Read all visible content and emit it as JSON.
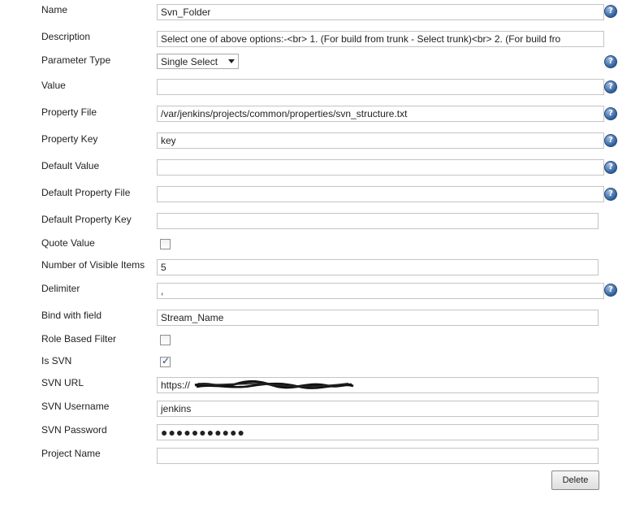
{
  "fields": {
    "name": {
      "label": "Name",
      "value": "Svn_Folder"
    },
    "description": {
      "label": "Description",
      "value": "Select one of above options:-<br> 1. (For build from trunk - Select trunk)<br> 2. (For build fro"
    },
    "parameter_type": {
      "label": "Parameter Type",
      "value": "Single Select"
    },
    "value": {
      "label": "Value",
      "value": ""
    },
    "property_file": {
      "label": "Property File",
      "value": "/var/jenkins/projects/common/properties/svn_structure.txt"
    },
    "property_key": {
      "label": "Property Key",
      "value": "key"
    },
    "default_value": {
      "label": "Default Value",
      "value": ""
    },
    "default_property_file": {
      "label": "Default Property File",
      "value": ""
    },
    "default_property_key": {
      "label": "Default Property Key",
      "value": ""
    },
    "quote_value": {
      "label": "Quote Value",
      "checked": false
    },
    "visible_items": {
      "label": "Number of Visible Items",
      "value": "5"
    },
    "delimiter": {
      "label": "Delimiter",
      "value": ","
    },
    "bind_with_field": {
      "label": "Bind with field",
      "value": "Stream_Name"
    },
    "role_based_filter": {
      "label": "Role Based Filter",
      "checked": false
    },
    "is_svn": {
      "label": "Is SVN",
      "checked": true
    },
    "svn_url": {
      "label": "SVN URL",
      "value": "https://"
    },
    "svn_username": {
      "label": "SVN Username",
      "value": "jenkins"
    },
    "svn_password": {
      "label": "SVN Password",
      "value": "●●●●●●●●●●●"
    },
    "project_name": {
      "label": "Project Name",
      "value": ""
    }
  },
  "help_icon": "question-mark-icon",
  "help_glyph": "?",
  "check_glyph": "✓",
  "delete_label": "Delete"
}
